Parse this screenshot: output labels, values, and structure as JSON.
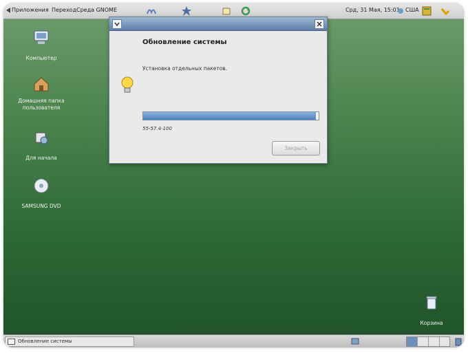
{
  "top_panel": {
    "menus": [
      "Приложения",
      "Переход",
      "Среда GNOME"
    ],
    "clock": "Срд, 31 Мая, 15:01",
    "keyboard_layout": "США",
    "icons": [
      "launcher-icon",
      "help-icon",
      "network-icon",
      "update-icon",
      "notes-icon",
      "refresh-icon",
      "notification-icon"
    ]
  },
  "desktop": {
    "icons": [
      {
        "label": "Компьютер",
        "icon": "computer-icon"
      },
      {
        "label": "Домашняя папка пользователя",
        "icon": "home-icon"
      },
      {
        "label": "Для начала",
        "icon": "tools-icon"
      },
      {
        "label": "SAMSUNG DVD",
        "icon": "dvd-icon"
      },
      {
        "label": "Корзина",
        "icon": "trash-icon"
      }
    ]
  },
  "dialog": {
    "title": "Обновление системы",
    "message": "Установка отдельных пакетов.",
    "progress_text": "55-57.4-100",
    "progress_fraction": 0.985,
    "button": "Закрыть",
    "icon": "lightbulb-icon"
  },
  "bottom_panel": {
    "taskbar_item": "Обновление системы",
    "workspaces": 4
  },
  "colors": {
    "desktop_top": "#6f9d6d",
    "desktop_bottom": "#1f5128",
    "titlebar": "#5d7ea9",
    "progress": "#4d7fc0"
  }
}
